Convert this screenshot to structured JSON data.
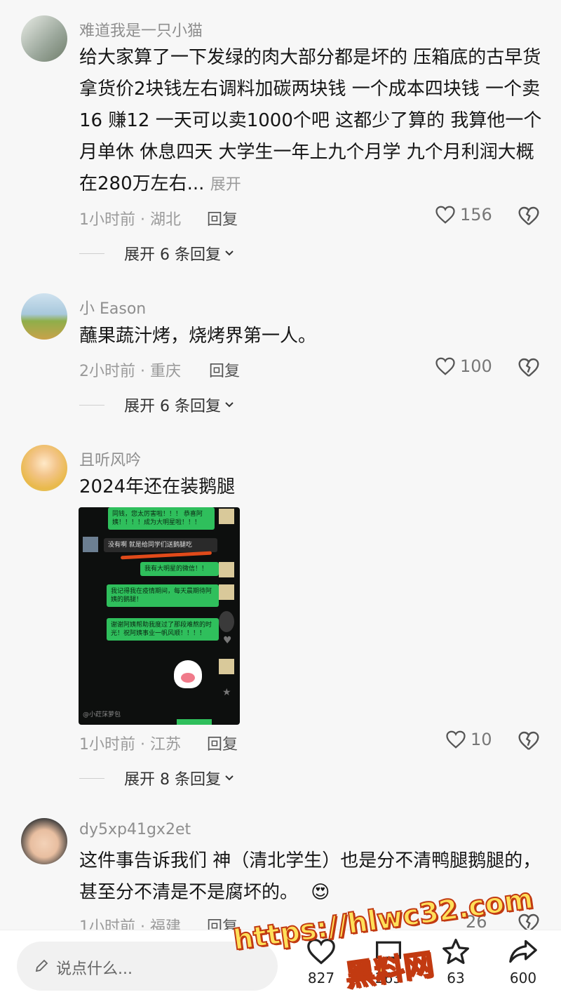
{
  "comments": [
    {
      "username": "难道我是一只小猫",
      "text": "给大家算了一下发绿的肉大部分都是坏的 压箱底的古早货 拿货价2块钱左右调料加碳两块钱 一个成本四块钱 一个卖16 赚12 一天可以卖1000个吧 这都少了算的 我算他一个月单休 休息四天 大学生一年上九个月学 九个月利润大概在280万左右...",
      "expand_inline": "展开",
      "meta": "1小时前 · 湖北",
      "reply": "回复",
      "likes": "156",
      "expand_replies": "展开 6 条回复"
    },
    {
      "username": "小 Eason",
      "text": "蘸果蔬汁烤，烧烤界第一人。",
      "meta": "2小时前 · 重庆",
      "reply": "回复",
      "likes": "100",
      "expand_replies": "展开 6 条回复"
    },
    {
      "username": "且听风吟",
      "text": "2024年还在装鹅腿",
      "chat_image": {
        "msg1": "同钱，您太厉害啦！！！ 恭喜阿姨！！！！成为大明星啦！！！",
        "msg2": "没有啊 就是给同学们送鹅腿吃",
        "msg3": "我有大明星的微信！！",
        "msg4": "我记得我在疫情期间，每天晨期待阿姨的鹅腿！",
        "msg5": "谢谢阿姨帮助我度过了那段难熬的时光！祝阿姨事业一帆风顺！！！！",
        "footer": "@小荭莯萝包"
      },
      "meta": "1小时前 · 江苏",
      "reply": "回复",
      "likes": "10",
      "expand_replies": "展开 8 条回复"
    },
    {
      "username": "dy5xp41gx2et",
      "text": "这件事告诉我们 神（清北学生）也是分不清鸭腿鹅腿的，甚至分不清是不是腐坏的。",
      "emoji": "😍",
      "meta": "1小时前 · 福建",
      "reply": "回复",
      "likes": "26"
    }
  ],
  "bottom_bar": {
    "input_placeholder": "说点什么...",
    "like_count": "827",
    "comment_count": "263",
    "star_count": "63",
    "share_count": "600"
  },
  "watermark": {
    "url": "https://hlwc32.com",
    "name": "黑料网"
  }
}
